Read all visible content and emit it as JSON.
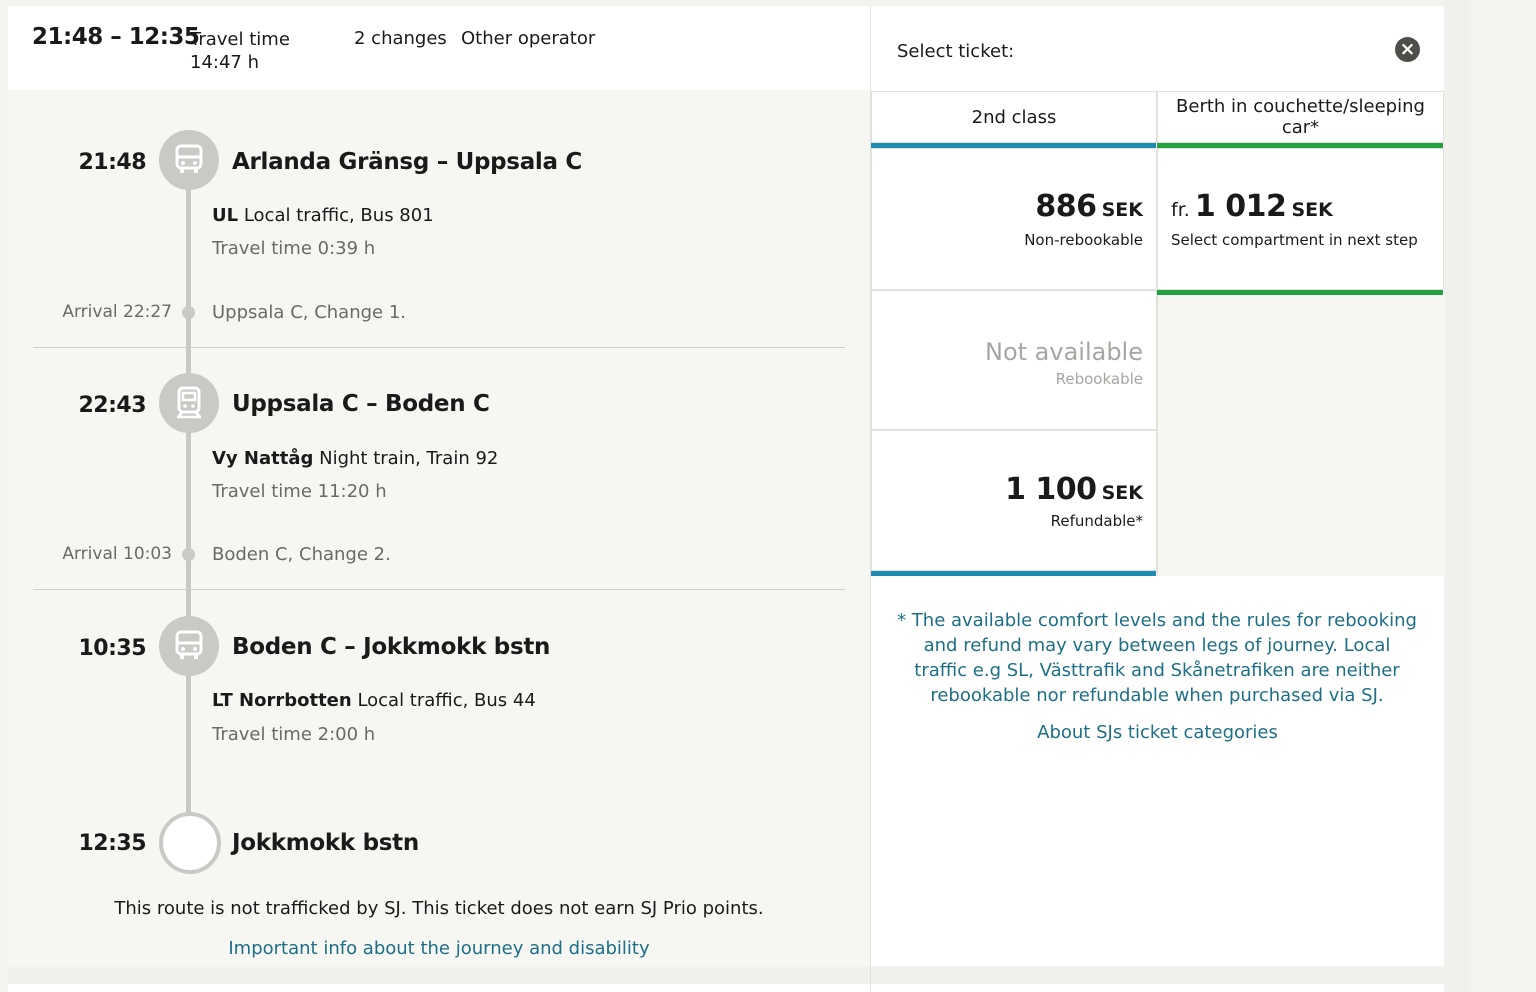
{
  "header": {
    "time_range": "21:48 – 12:35",
    "travel_time": "Travel time 14:47 h",
    "changes": "2 changes",
    "operator": "Other operator"
  },
  "legs": [
    {
      "departure": "21:48",
      "title": "Arlanda Gränsg – Uppsala C",
      "operator_code": "UL",
      "service": "Local traffic, Bus 801",
      "travel_time": "Travel time 0:39 h",
      "arrival": "Arrival 22:27",
      "arrival_stop": "Uppsala C, Change 1.",
      "icon": "bus-icon"
    },
    {
      "departure": "22:43",
      "title": "Uppsala C – Boden C",
      "operator_code": "Vy Nattåg",
      "service": "Night train, Train 92",
      "travel_time": "Travel time 11:20 h",
      "arrival": "Arrival 10:03",
      "arrival_stop": "Boden C, Change 2.",
      "icon": "train-icon"
    },
    {
      "departure": "10:35",
      "title": "Boden C – Jokkmokk bstn",
      "operator_code": "LT Norrbotten",
      "service": "Local traffic, Bus 44",
      "travel_time": "Travel time 2:00 h",
      "icon": "bus-icon"
    }
  ],
  "final_stop": {
    "time": "12:35",
    "name": "Jokkmokk bstn"
  },
  "notice": "This route is not trafficked by SJ. This ticket does not earn SJ Prio points.",
  "info_link": "Important info about the journey and disability",
  "ticket_panel": {
    "title": "Select ticket:",
    "columns": [
      "2nd class",
      "Berth in couchette/sleeping car*"
    ],
    "second_class": [
      {
        "price": "886",
        "currency": "SEK",
        "label": "Non-rebookable"
      },
      {
        "price": "Not available",
        "label": "Rebookable"
      },
      {
        "price": "1 100",
        "currency": "SEK",
        "label": "Refundable*"
      }
    ],
    "berth": {
      "prefix": "fr.",
      "price": "1 012",
      "currency": "SEK",
      "label": "Select compartment in next step"
    },
    "footnote": "* The available comfort levels and the rules for rebooking and refund may vary between legs of journey. Local traffic e.g SL, Västtrafik and Skånetrafiken are neither rebookable nor refundable when purchased via SJ.",
    "about_link": "About SJs ticket categories"
  },
  "colors": {
    "accent_blue": "#1e8cb0",
    "accent_green": "#22a13e",
    "link": "#1d6f86"
  }
}
